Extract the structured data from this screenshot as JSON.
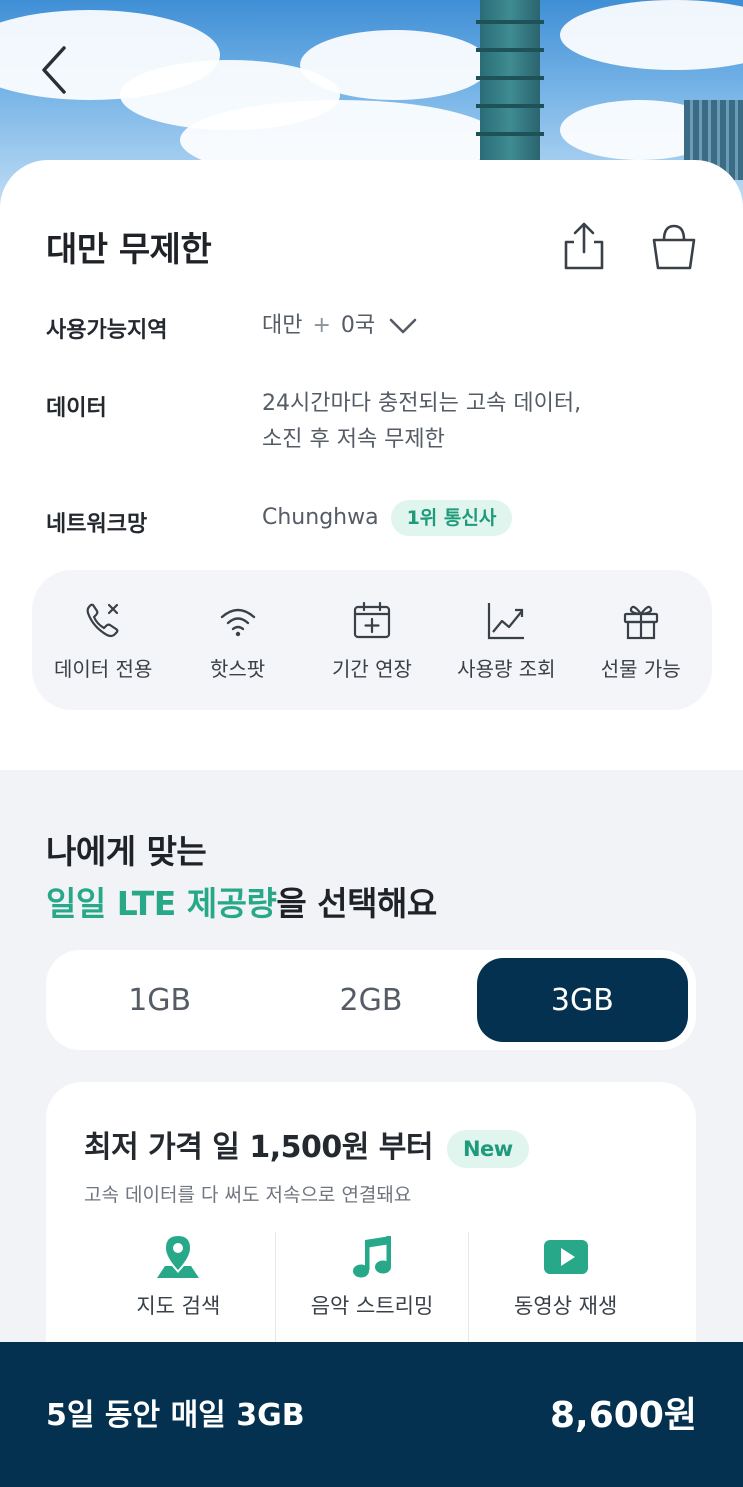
{
  "product": {
    "title": "대만 무제한",
    "region_label": "사용가능지역",
    "region_value": "대만",
    "region_extra": "0국",
    "data_label": "데이터",
    "data_line1": "24시간마다 충전되는 고속 데이터,",
    "data_line2": "소진 후 저속 무제한",
    "network_label": "네트워크망",
    "network_value": "Chunghwa",
    "network_badge": "1위 통신사"
  },
  "features": [
    {
      "icon": "phone-off-icon",
      "label": "데이터 전용"
    },
    {
      "icon": "wifi-icon",
      "label": "핫스팟"
    },
    {
      "icon": "calendar-plus-icon",
      "label": "기간 연장"
    },
    {
      "icon": "chart-icon",
      "label": "사용량 조회"
    },
    {
      "icon": "gift-icon",
      "label": "선물 가능"
    }
  ],
  "select": {
    "headline_line1": "나에게 맞는",
    "headline_accent": "일일 LTE 제공량",
    "headline_rest": "을 선택해요",
    "options": [
      "1GB",
      "2GB",
      "3GB"
    ],
    "selected": "3GB"
  },
  "price_card": {
    "title": "최저 가격 일 1,500원 부터",
    "badge": "New",
    "subtitle": "고속 데이터를 다 써도 저속으로 연결돼요",
    "uses": [
      {
        "icon": "map-pin-icon",
        "label": "지도 검색"
      },
      {
        "icon": "music-icon",
        "label": "음악 스트리밍"
      },
      {
        "icon": "video-play-icon",
        "label": "동영상 재생"
      }
    ]
  },
  "summary": {
    "plan": "5일 동안 매일 3GB",
    "price": "8,600원"
  },
  "colors": {
    "accent": "#26a889",
    "navy": "#04314f"
  }
}
